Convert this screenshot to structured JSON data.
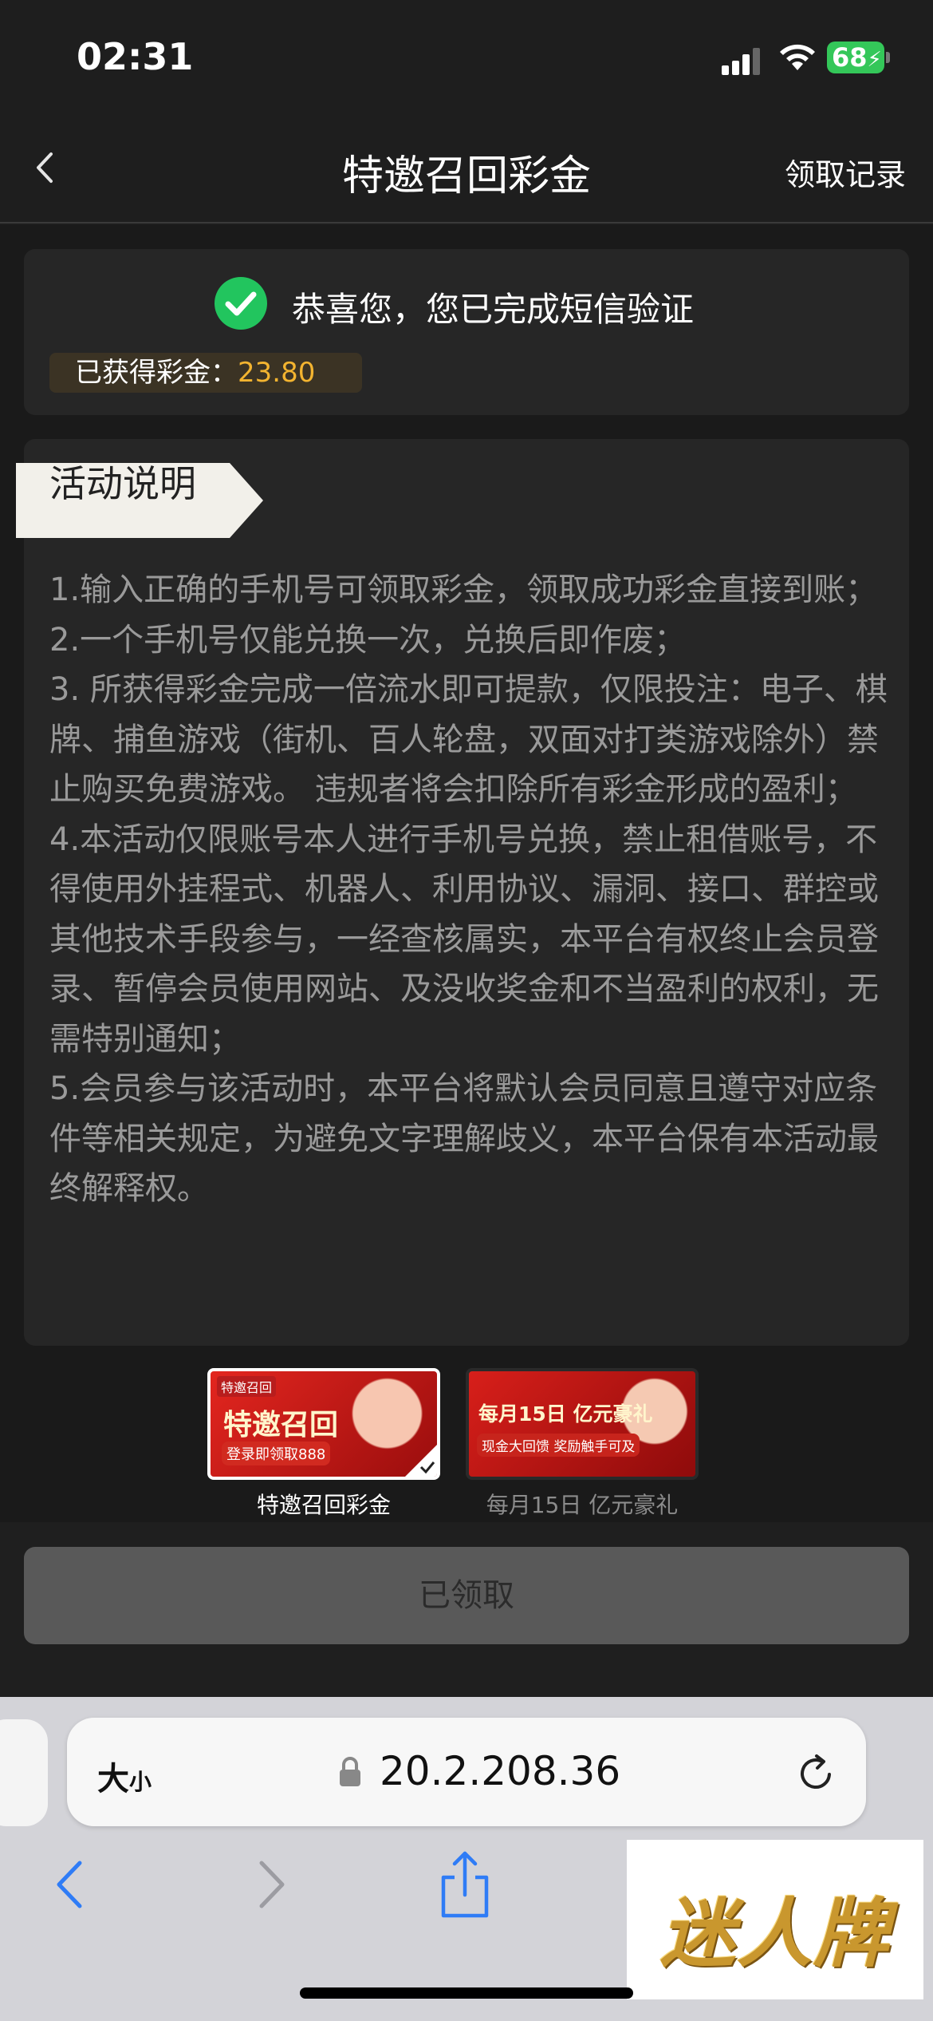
{
  "status_bar": {
    "time": "02:31",
    "battery": "68"
  },
  "nav": {
    "title": "特邀召回彩金",
    "records_link": "领取记录"
  },
  "success": {
    "message": "恭喜您，您已完成短信验证",
    "bonus_label": "已获得彩金：",
    "bonus_value": "23.80",
    "accent_color": "#f3b430",
    "check_color": "#22c55e"
  },
  "rules": {
    "tag_label": "活动说明",
    "items": [
      "1.输入正确的手机号可领取彩金，领取成功彩金直接到账；",
      "2.一个手机号仅能兑换一次，兑换后即作废；",
      "3. 所获得彩金完成一倍流水即可提款，仅限投注：电子、棋牌、捕鱼游戏（街机、百人轮盘，双面对打类游戏除外）禁止购买免费游戏。 违规者将会扣除所有彩金形成的盈利；",
      "4.本活动仅限账号本人进行手机号兑换，禁止租借账号，不得使用外挂程式、机器人、利用协议、漏洞、接口、群控或其他技术手段参与，一经查核属实，本平台有权终止会员登录、暂停会员使用网站、及没收奖金和不当盈利的权利，无需特别通知；",
      "5.会员参与该活动时，本平台将默认会员同意且遵守对应条件等相关规定，为避免文字理解歧义，本平台保有本活动最终解释权。"
    ]
  },
  "promos": [
    {
      "caption": "特邀召回彩金",
      "badge": "特邀召回",
      "headline": "特邀召回",
      "sub": "登录即领取888",
      "selected": true
    },
    {
      "caption": "每月15日 亿元豪礼",
      "headline": "每月15日 亿元豪礼",
      "sub": "现金大回馈  奖励触手可及",
      "selected": false
    }
  ],
  "claim_button": "已领取",
  "browser": {
    "aa_big": "大",
    "aa_small": "小",
    "url": "20.2.208.36",
    "accent_color": "#2f7cf6"
  },
  "watermark": "迷人牌"
}
